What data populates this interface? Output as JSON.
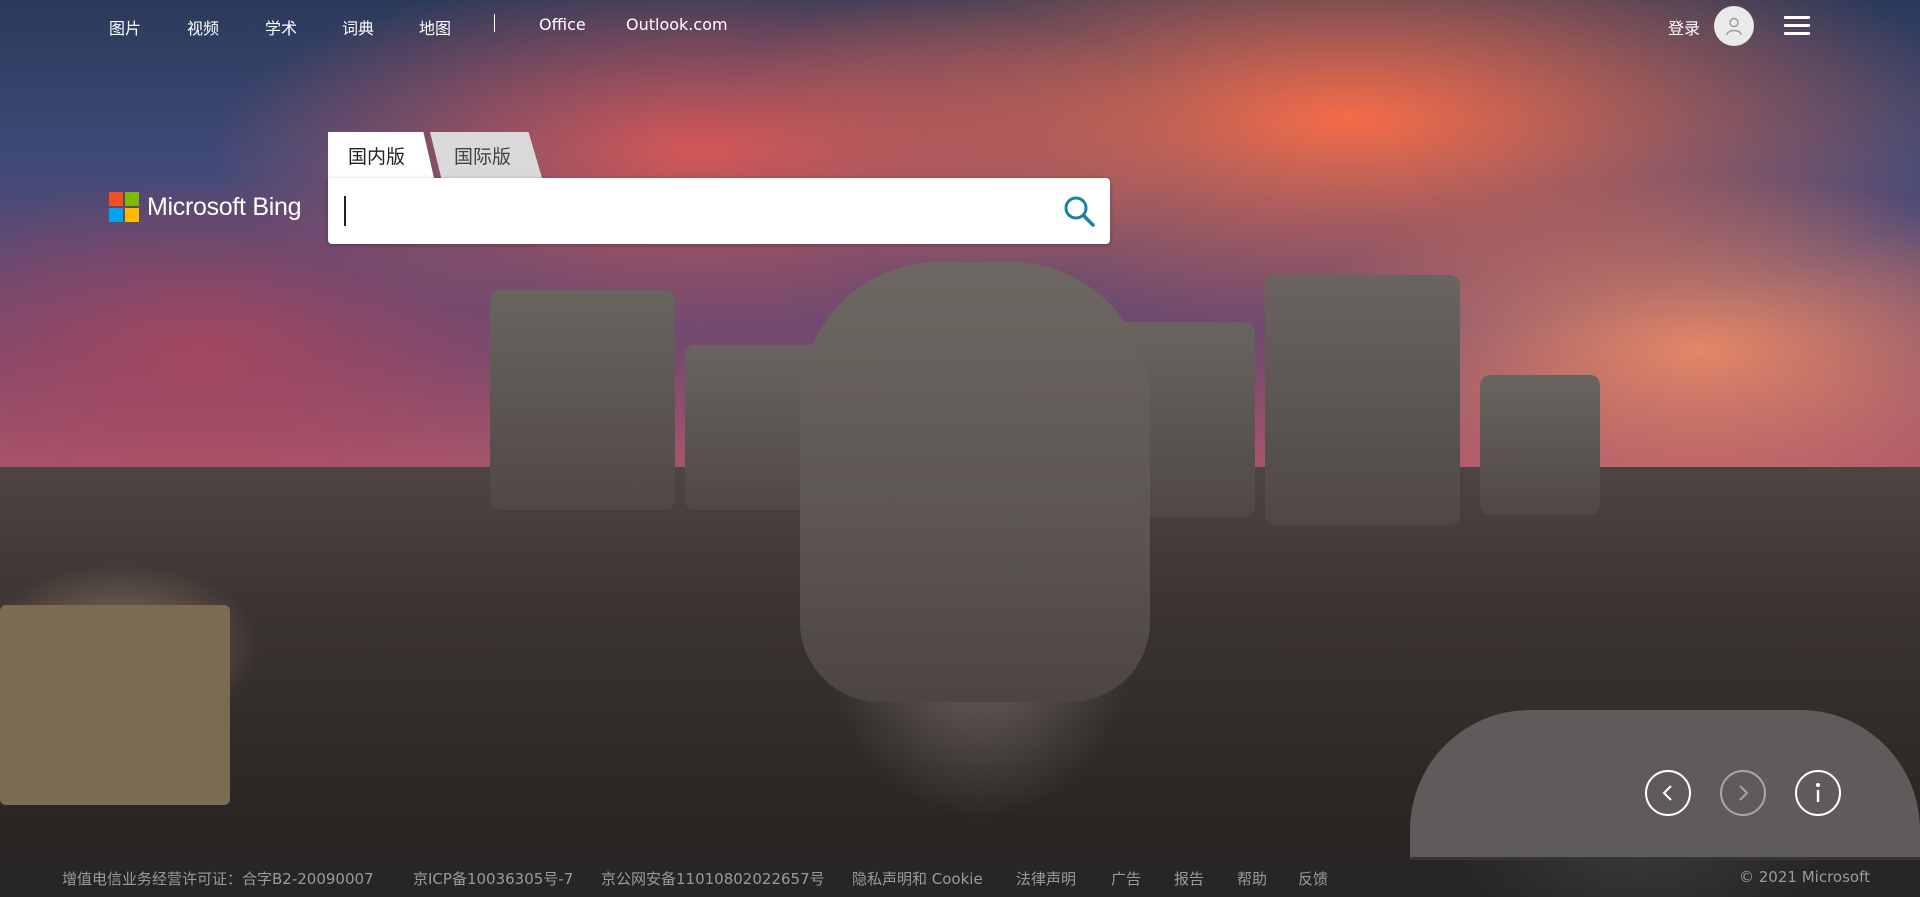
{
  "top_nav": {
    "items": [
      "图片",
      "视频",
      "学术",
      "词典",
      "地图",
      "Office",
      "Outlook.com"
    ],
    "signin_label": "登录"
  },
  "logo": {
    "text": "Microsoft Bing"
  },
  "search": {
    "tabs": [
      "国内版",
      "国际版"
    ],
    "active_tab": "国内版",
    "value": "",
    "placeholder": ""
  },
  "colors": {
    "ms_red": "#f25022",
    "ms_green": "#7fba00",
    "ms_blue": "#00a4ef",
    "ms_yellow": "#ffb900",
    "search_icon": "#1c7fa3"
  },
  "carousel": {
    "prev_icon": "chevron-left-icon",
    "next_icon": "chevron-right-icon",
    "info_icon": "info-icon"
  },
  "footer": {
    "links": [
      "增值电信业务经营许可证：合字B2-20090007",
      "京ICP备10036305号-7",
      "京公网安备11010802022657号",
      "隐私声明和 Cookie",
      "法律声明",
      "广告",
      "报告",
      "帮助",
      "反馈"
    ],
    "copyright": "© 2021 Microsoft"
  }
}
